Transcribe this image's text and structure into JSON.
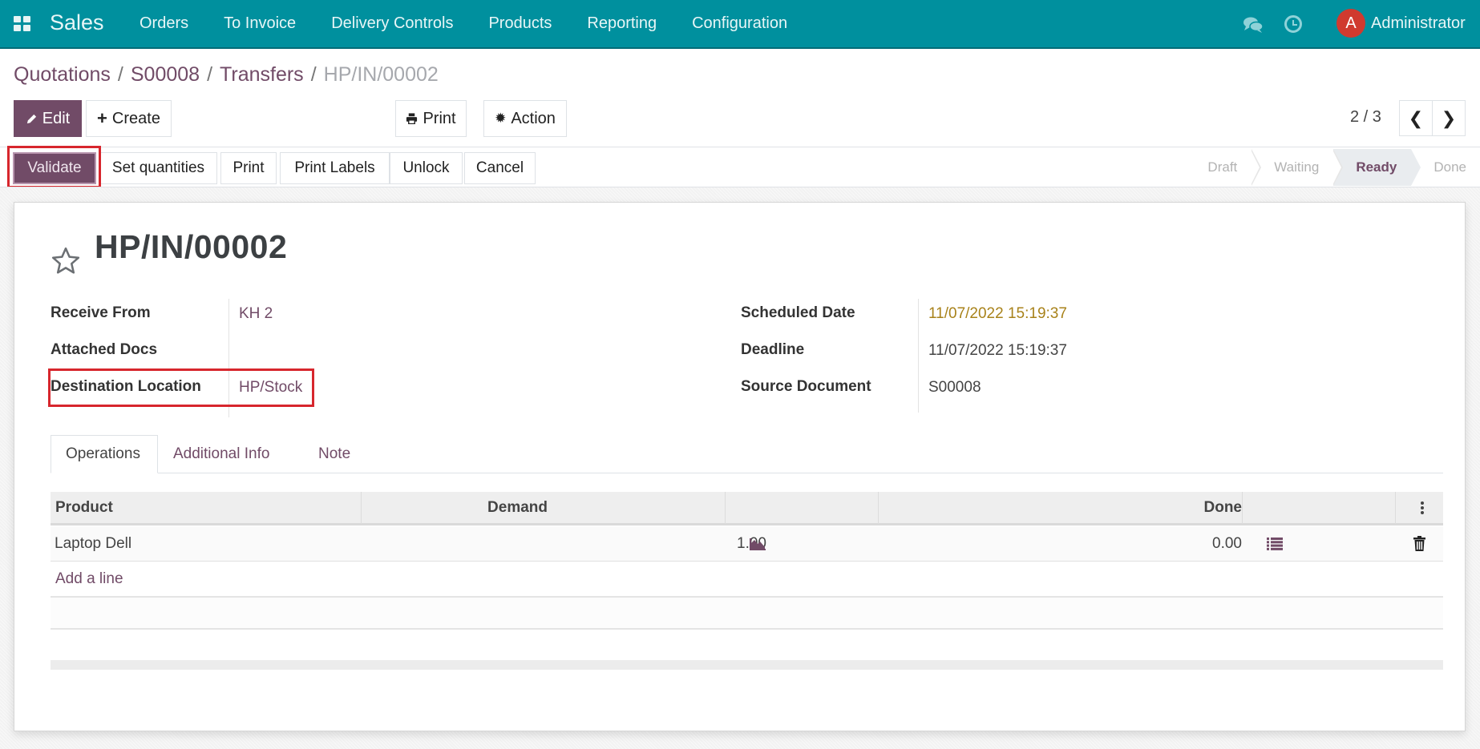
{
  "navbar": {
    "app_icon": "apps-grid-icon",
    "brand": "Sales",
    "menu": [
      "Orders",
      "To Invoice",
      "Delivery Controls",
      "Products",
      "Reporting",
      "Configuration"
    ],
    "chat_icon": "chat-icon",
    "activity_icon": "clock-icon",
    "avatar_initial": "A",
    "user_name": "Administrator",
    "color": "#00909e"
  },
  "breadcrumb": {
    "items": [
      "Quotations",
      "S00008",
      "Transfers"
    ],
    "separator": "/",
    "current": "HP/IN/00002"
  },
  "control_panel": {
    "edit_label": "Edit",
    "create_label": "Create",
    "print_label": "Print",
    "action_label": "Action",
    "pager": "2 / 3",
    "prev_glyph": "❮",
    "next_glyph": "❯"
  },
  "statusbar_buttons": [
    "Validate",
    "Set quantities",
    "Print",
    "Print Labels",
    "Unlock",
    "Cancel"
  ],
  "stages": [
    {
      "label": "Draft",
      "active": false
    },
    {
      "label": "Waiting",
      "active": false
    },
    {
      "label": "Ready",
      "active": true
    },
    {
      "label": "Done",
      "active": false
    }
  ],
  "record": {
    "name": "HP/IN/00002",
    "favorite": false,
    "left_fields": [
      {
        "label": "Receive From",
        "value": "KH 2"
      },
      {
        "label": "Attached Docs",
        "value": ""
      },
      {
        "label": "Destination Location",
        "value": "HP/Stock"
      }
    ],
    "right_fields": [
      {
        "label": "Scheduled Date",
        "value": "11/07/2022 15:19:37"
      },
      {
        "label": "Deadline",
        "value": "11/07/2022 15:19:37"
      },
      {
        "label": "Source Document",
        "value": "S00008"
      }
    ]
  },
  "tabs": [
    "Operations",
    "Additional Info",
    "Note"
  ],
  "table": {
    "columns": [
      "Product",
      "Demand",
      "",
      "Done",
      ""
    ],
    "rows": [
      {
        "product": "Laptop Dell",
        "demand": "1.00",
        "done": "0.00"
      }
    ],
    "add_line": "Add a line"
  },
  "accent_color": "#714b67",
  "highlight_color": "#d7262d"
}
